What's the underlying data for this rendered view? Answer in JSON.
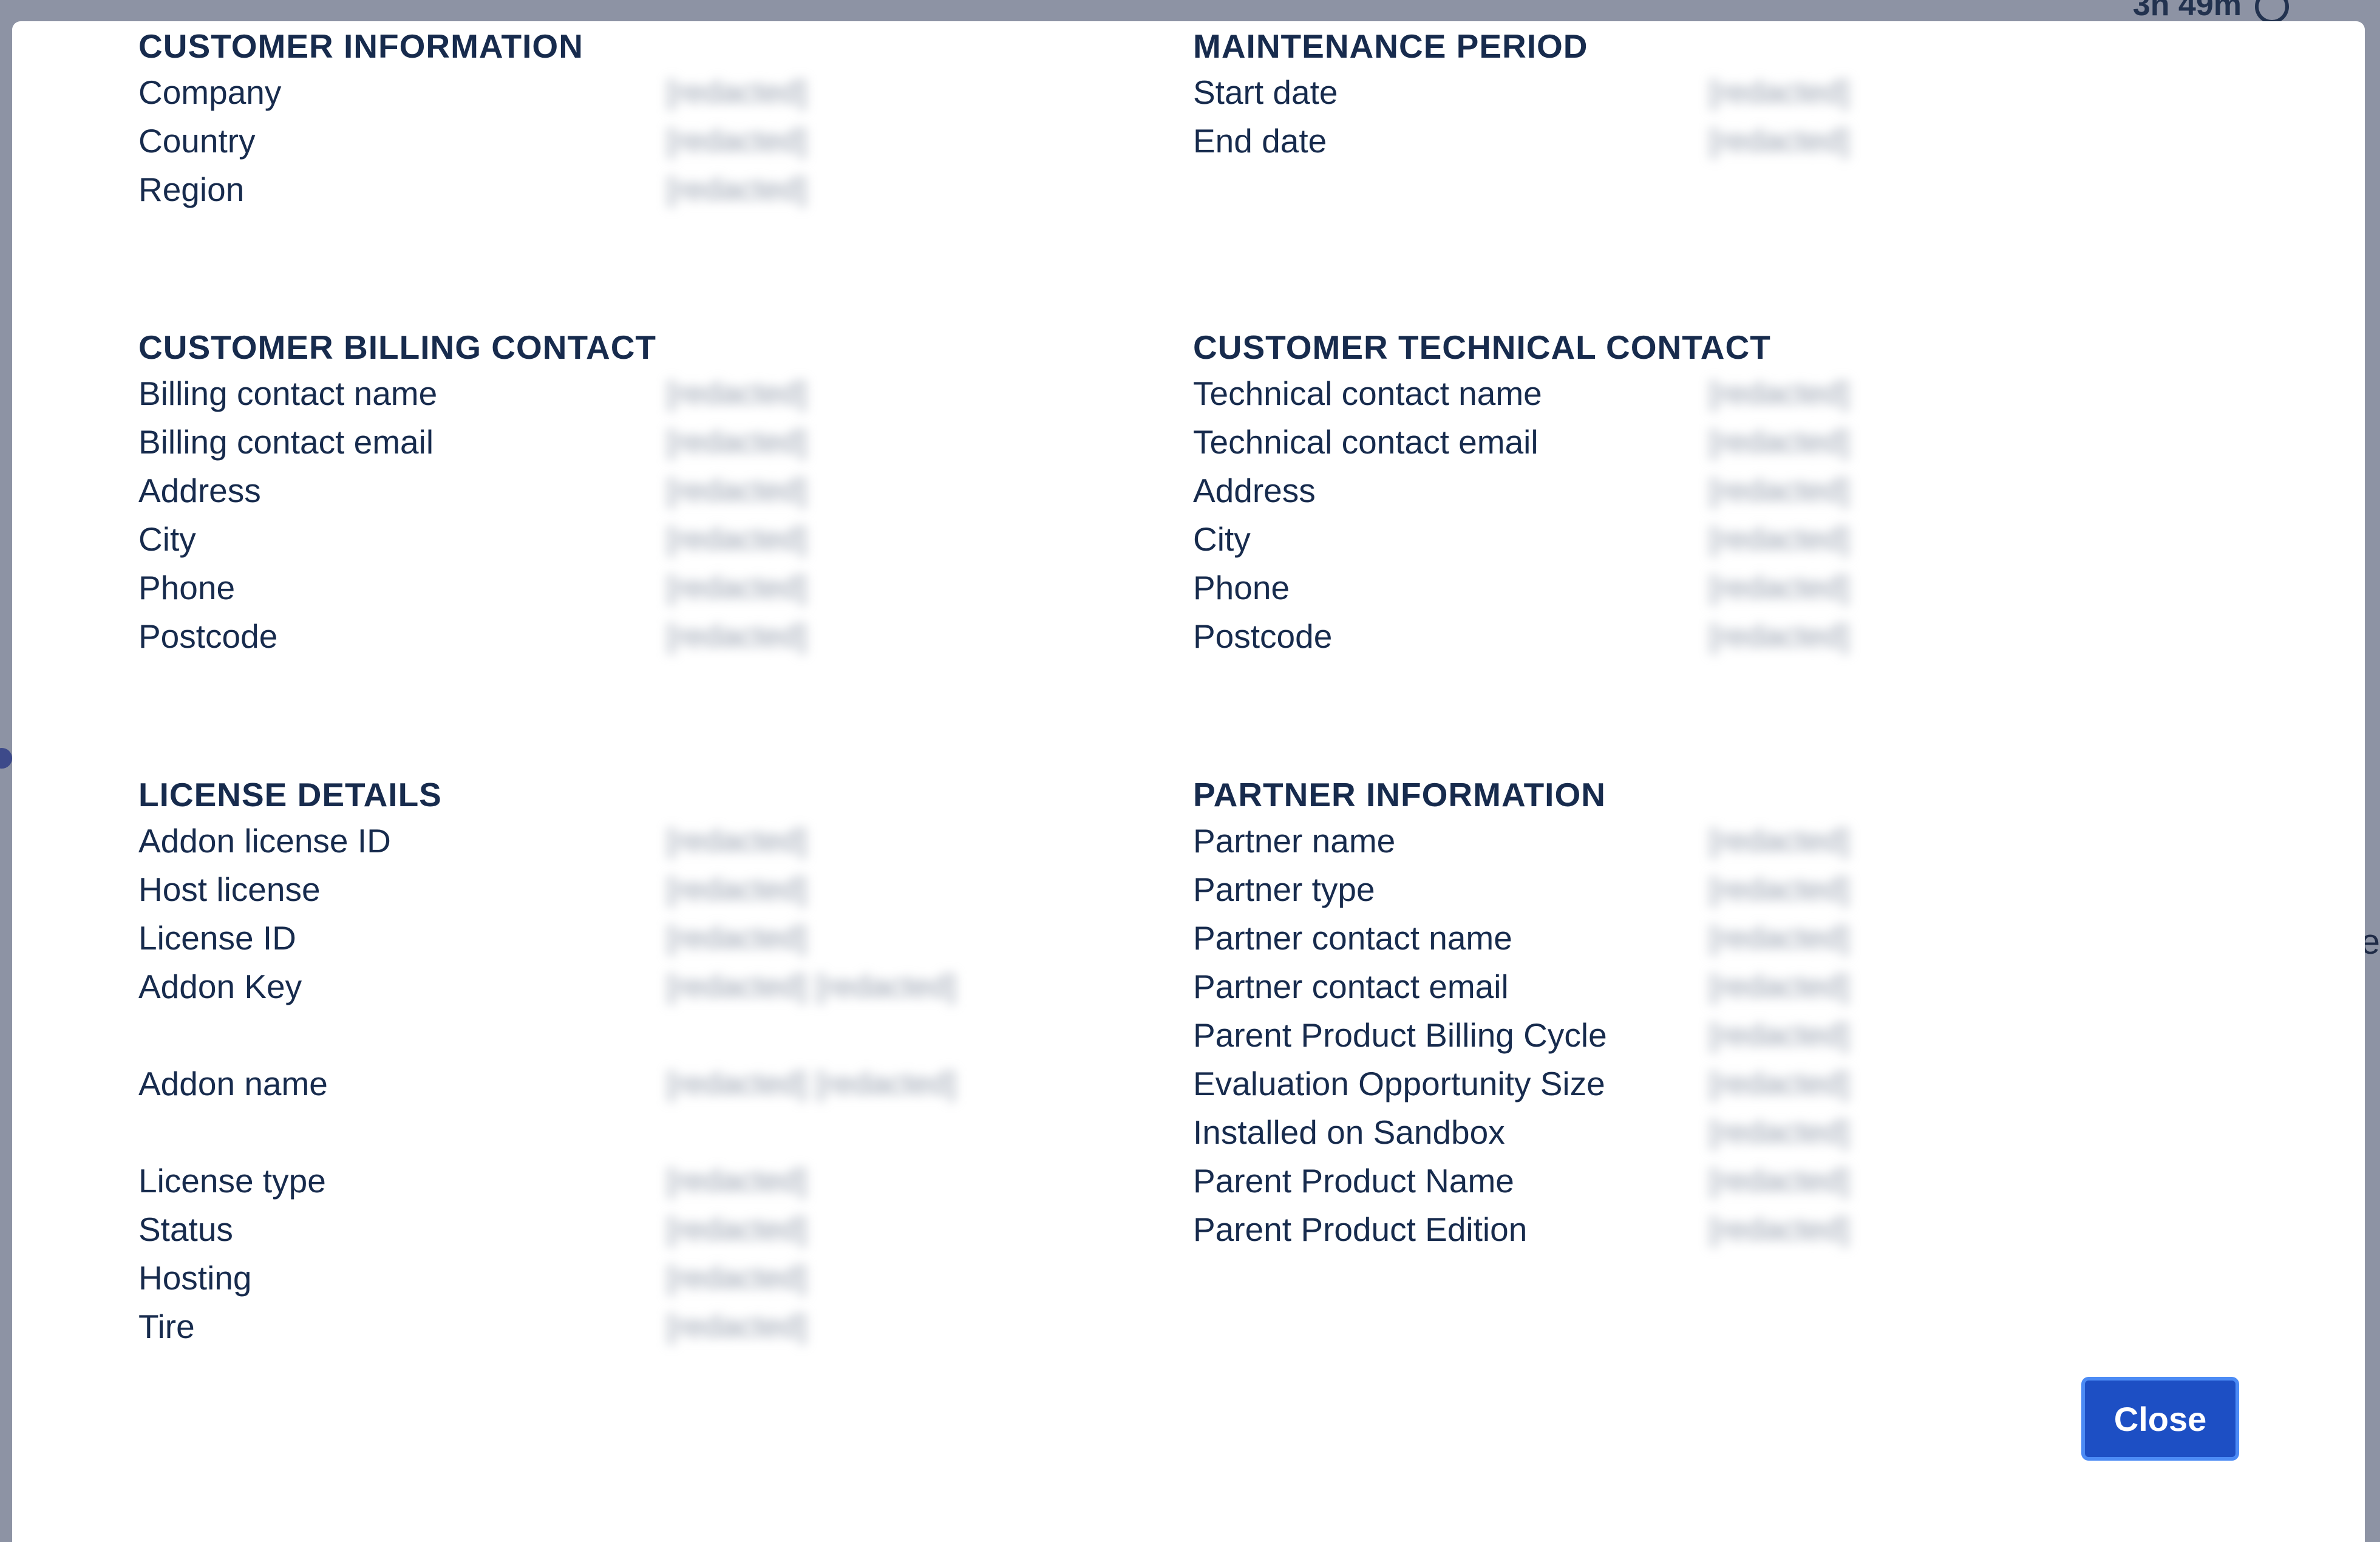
{
  "background": {
    "timer_text": "3h 49m",
    "right_letter": "e"
  },
  "sections": {
    "customer_information": {
      "title": "CUSTOMER INFORMATION",
      "rows": [
        {
          "label": "Company",
          "value": "[redacted]"
        },
        {
          "label": "Country",
          "value": "[redacted]"
        },
        {
          "label": "Region",
          "value": "[redacted]"
        }
      ]
    },
    "maintenance_period": {
      "title": "MAINTENANCE PERIOD",
      "rows": [
        {
          "label": "Start date",
          "value": "[redacted]"
        },
        {
          "label": "End date",
          "value": "[redacted]"
        }
      ]
    },
    "customer_billing_contact": {
      "title": "CUSTOMER BILLING CONTACT",
      "rows": [
        {
          "label": "Billing contact name",
          "value": "[redacted]"
        },
        {
          "label": "Billing contact email",
          "value": "[redacted]"
        },
        {
          "label": "Address",
          "value": "[redacted]"
        },
        {
          "label": "City",
          "value": "[redacted]"
        },
        {
          "label": "Phone",
          "value": "[redacted]"
        },
        {
          "label": "Postcode",
          "value": "[redacted]"
        }
      ]
    },
    "customer_technical_contact": {
      "title": "CUSTOMER TECHNICAL CONTACT",
      "rows": [
        {
          "label": "Technical contact name",
          "value": "[redacted]"
        },
        {
          "label": "Technical contact email",
          "value": "[redacted]"
        },
        {
          "label": "Address",
          "value": "[redacted]"
        },
        {
          "label": "City",
          "value": "[redacted]"
        },
        {
          "label": "Phone",
          "value": "[redacted]"
        },
        {
          "label": "Postcode",
          "value": "[redacted]"
        }
      ]
    },
    "license_details": {
      "title": "LICENSE DETAILS",
      "rows": [
        {
          "label": "Addon license ID",
          "value": "[redacted]"
        },
        {
          "label": "Host license",
          "value": "[redacted]"
        },
        {
          "label": "License ID",
          "value": "[redacted]"
        },
        {
          "label": "Addon Key",
          "value": "[redacted] [redacted]"
        },
        {
          "label": "Addon name",
          "value": "[redacted] [redacted]"
        },
        {
          "label": "License type",
          "value": "[redacted]"
        },
        {
          "label": "Status",
          "value": "[redacted]"
        },
        {
          "label": "Hosting",
          "value": "[redacted]"
        },
        {
          "label": "Tire",
          "value": "[redacted]"
        }
      ]
    },
    "partner_information": {
      "title": "PARTNER INFORMATION",
      "rows": [
        {
          "label": "Partner name",
          "value": "[redacted]"
        },
        {
          "label": "Partner type",
          "value": "[redacted]"
        },
        {
          "label": "Partner contact name",
          "value": "[redacted]"
        },
        {
          "label": "Partner contact email",
          "value": "[redacted]"
        },
        {
          "label": "Parent Product Billing Cycle",
          "value": "[redacted]"
        },
        {
          "label": "Evaluation Opportunity Size",
          "value": "[redacted]"
        },
        {
          "label": "Installed on Sandbox",
          "value": "[redacted]"
        },
        {
          "label": "Parent Product Name",
          "value": "[redacted]"
        },
        {
          "label": "Parent Product Edition",
          "value": "[redacted]"
        }
      ]
    }
  },
  "footer": {
    "close_label": "Close"
  },
  "colors": {
    "overlay": "#8d93a4",
    "heading_text": "#172b4d",
    "primary_button": "#1d4fc4",
    "button_focus_ring": "#4c8bf5"
  }
}
